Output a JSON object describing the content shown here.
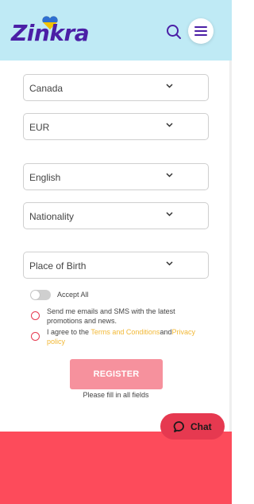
{
  "header": {
    "logo_text": "Zinkra",
    "search_icon": "search-icon",
    "menu_icon": "hamburger-icon",
    "accent_color": "#4b1fa6",
    "background": "#bfeaf5"
  },
  "form": {
    "country": "Canada",
    "currency": "EUR",
    "language": "English",
    "nationality": "Nationality",
    "place_of_birth": "Place of Birth",
    "accept_all_label": "Accept All",
    "consent_marketing": "Send me emails and SMS with the latest promotions and news.",
    "consent_terms_prefix": "I agree to the ",
    "terms_link": "Terms and Conditions",
    "consent_and": "and",
    "privacy_link": "Privacy policy",
    "register_label": "REGISTER",
    "hint": "Please fill in all fields",
    "chevron_icon": "chevron-down-icon",
    "radio_color": "#e63950",
    "link_color": "#f2b835",
    "register_color": "#f6919d"
  },
  "chat": {
    "label": "Chat",
    "icon": "chat-bubble-icon",
    "color": "#e63950"
  },
  "footer": {
    "background": "#fd4b5b"
  }
}
